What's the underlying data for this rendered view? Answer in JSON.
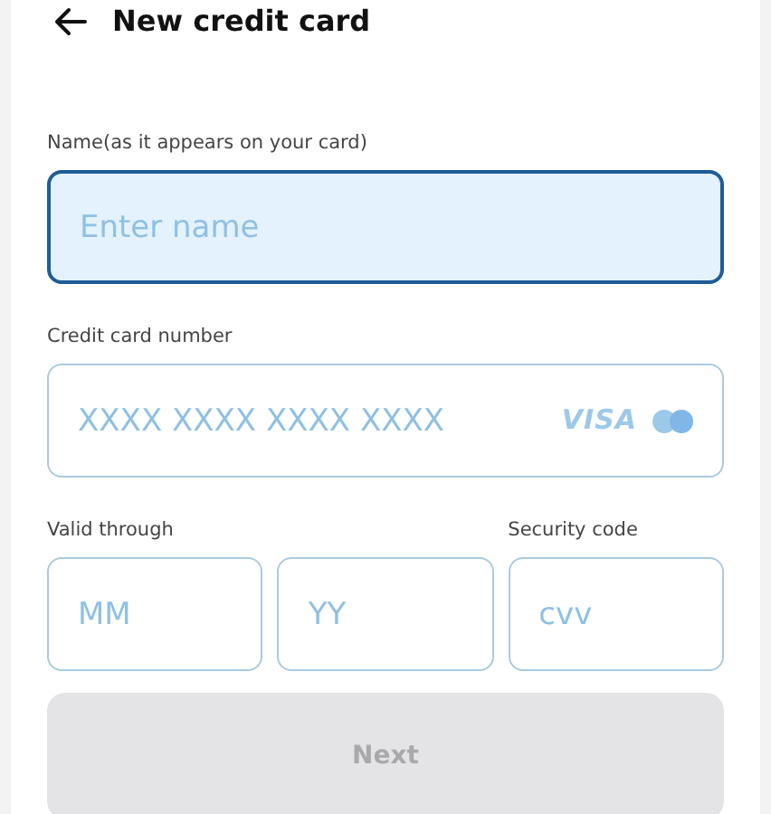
{
  "header": {
    "title": "New credit card"
  },
  "name_field": {
    "label": "Name(as it appears on your card)",
    "placeholder": "Enter name",
    "focused": true
  },
  "card_number_field": {
    "label": "Credit card number",
    "placeholder": "XXXX XXXX XXXX XXXX",
    "brand": "VISA"
  },
  "valid_through": {
    "label": "Valid through",
    "fields": [
      {
        "placeholder": "MM",
        "focused": false
      },
      {
        "placeholder": "YY",
        "focused": false
      }
    ]
  },
  "security_code": {
    "label": "Security code",
    "placeholder": "cvv",
    "focused": false
  },
  "next_button": {
    "label": "Next",
    "disabled": true
  }
}
